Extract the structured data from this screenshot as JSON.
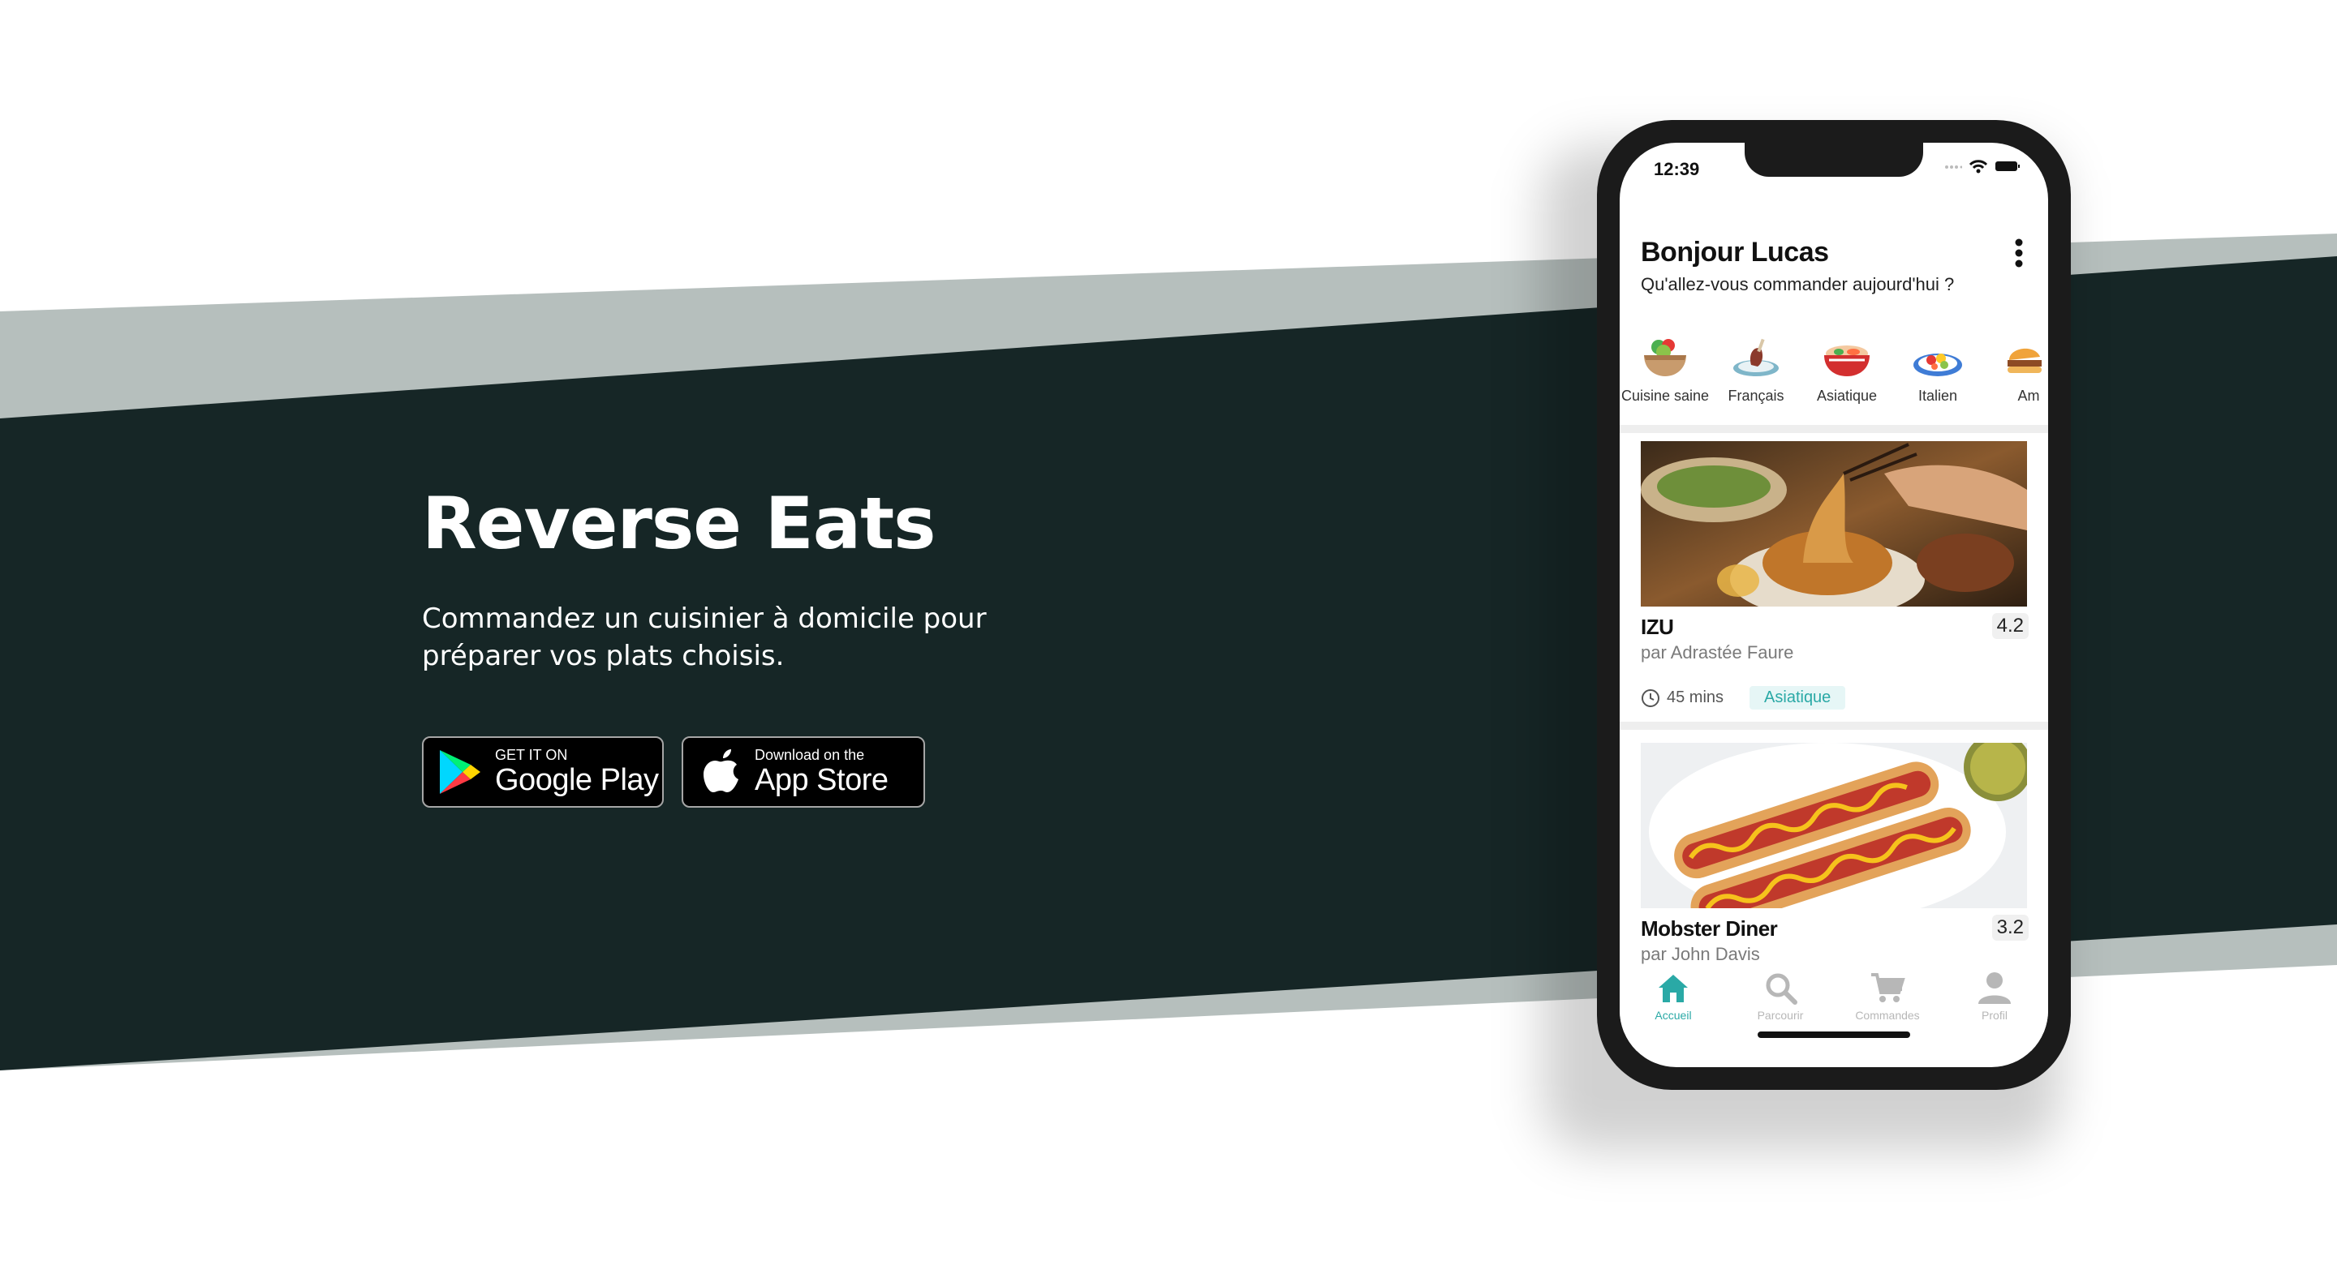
{
  "colors": {
    "dark_band": "#162626",
    "light_band": "#b6bfbd",
    "accent": "#2aa9a6"
  },
  "hero": {
    "title": "Reverse Eats",
    "subtitle": "Commandez un cuisinier à domicile pour préparer vos plats choisis."
  },
  "stores": {
    "google_small": "GET IT ON",
    "google_big": "Google Play",
    "apple_small": "Download on the",
    "apple_big": "App Store"
  },
  "phone": {
    "time": "12:39",
    "greeting": "Bonjour Lucas",
    "question": "Qu'allez-vous commander aujourd'hui ?",
    "categories": [
      {
        "label": "Cuisine saine",
        "icon": "salad-bowl-icon"
      },
      {
        "label": "Français",
        "icon": "french-plate-icon"
      },
      {
        "label": "Asiatique",
        "icon": "asian-bowl-icon"
      },
      {
        "label": "Italien",
        "icon": "italian-plate-icon"
      },
      {
        "label": "Am",
        "icon": "american-food-icon"
      }
    ],
    "restaurants": [
      {
        "name": "IZU",
        "by": "par Adrastée Faure",
        "rating": "4.2",
        "time": "45 mins",
        "tag": "Asiatique",
        "image": "noodles-photo"
      },
      {
        "name": "Mobster Diner",
        "by": "par John Davis",
        "rating": "3.2",
        "image": "hotdogs-photo"
      }
    ],
    "tabs": [
      {
        "label": "Accueil",
        "icon": "home-icon",
        "active": true
      },
      {
        "label": "Parcourir",
        "icon": "search-icon",
        "active": false
      },
      {
        "label": "Commandes",
        "icon": "cart-icon",
        "active": false
      },
      {
        "label": "Profil",
        "icon": "user-icon",
        "active": false
      }
    ]
  }
}
